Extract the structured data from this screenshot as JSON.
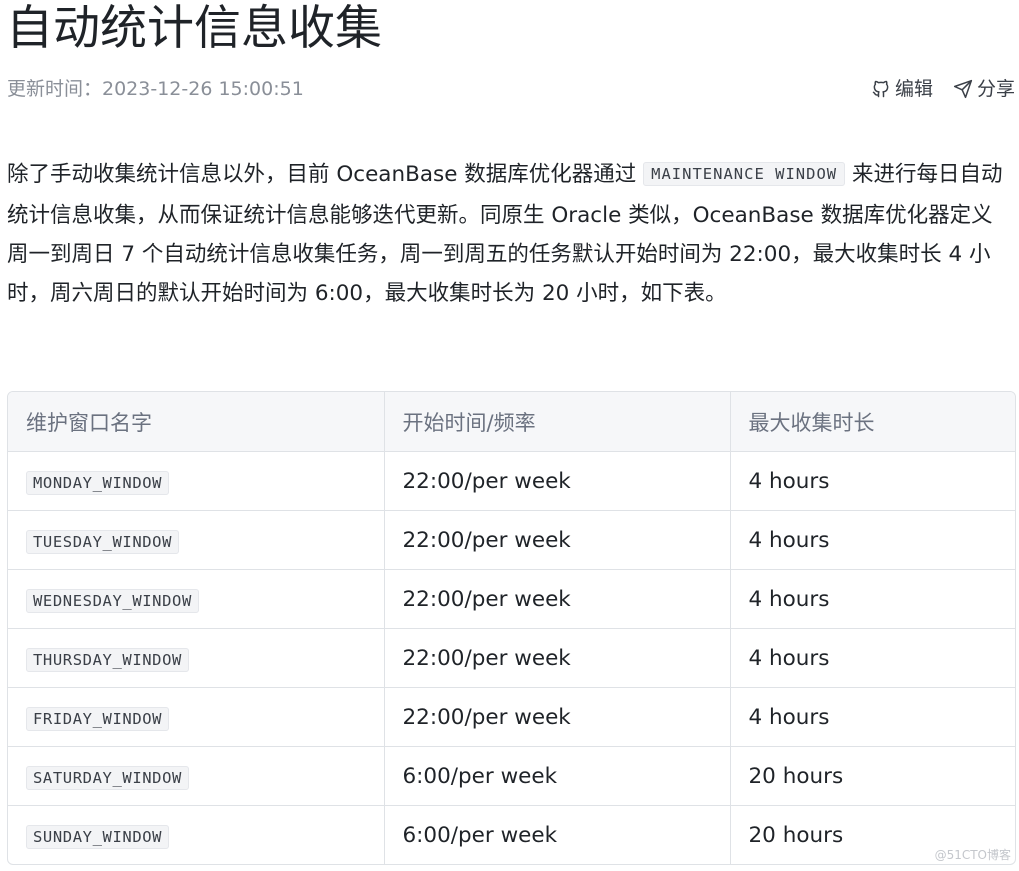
{
  "title": "自动统计信息收集",
  "meta": {
    "updated": "更新时间：2023-12-26 15:00:51",
    "actions": [
      {
        "label": "编辑",
        "icon": "github-icon"
      },
      {
        "label": "分享",
        "icon": "send-icon"
      }
    ]
  },
  "paragraph": {
    "before_code": "除了手动收集统计信息以外，目前 OceanBase 数据库优化器通过 ",
    "code": "MAINTENANCE WINDOW",
    "after_code": " 来进行每日自动统计信息收集，从而保证统计信息能够迭代更新。同原生 Oracle 类似，OceanBase 数据库优化器定义周一到周日 7 个自动统计信息收集任务，周一到周五的任务默认开始时间为 22:00，最大收集时长 4 小时，周六周日的默认开始时间为 6:00，最大收集时长为 20 小时，如下表。"
  },
  "table": {
    "headers": [
      "维护窗口名字",
      "开始时间/频率",
      "最大收集时长"
    ],
    "rows": [
      {
        "name": "MONDAY_WINDOW",
        "start": "22:00/per week",
        "duration": "4 hours"
      },
      {
        "name": "TUESDAY_WINDOW",
        "start": "22:00/per week",
        "duration": "4 hours"
      },
      {
        "name": "WEDNESDAY_WINDOW",
        "start": "22:00/per week",
        "duration": "4 hours"
      },
      {
        "name": "THURSDAY_WINDOW",
        "start": "22:00/per week",
        "duration": "4 hours"
      },
      {
        "name": "FRIDAY_WINDOW",
        "start": "22:00/per week",
        "duration": "4 hours"
      },
      {
        "name": "SATURDAY_WINDOW",
        "start": "6:00/per week",
        "duration": "20 hours"
      },
      {
        "name": "SUNDAY_WINDOW",
        "start": "6:00/per week",
        "duration": "20 hours"
      }
    ]
  },
  "watermark": "@51CTO博客"
}
